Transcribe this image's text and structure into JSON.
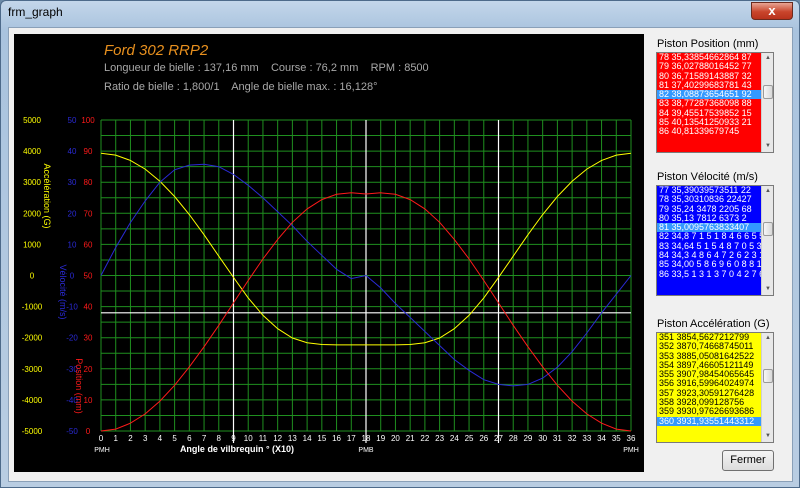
{
  "window": {
    "title": "frm_graph",
    "close_glyph": "x"
  },
  "graph": {
    "title": "Ford 302 RRP2",
    "info_line1": "Longueur de bielle : 137,16 mm    Course : 76,2 mm    RPM : 8500",
    "info_line2": "Ratio de bielle : 1,800/1    Angle de bielle max. : 16,128°",
    "xlabel": "Angle de vilbrequin ° (X10)",
    "marker_left": "PMH",
    "marker_mid": "PMB",
    "marker_right": "PMH",
    "colors": {
      "accel": "#ffff00",
      "vel": "#2a2ad6",
      "pos": "#ff1a1a",
      "grid": "#1f8f1f",
      "title": "#e8901e"
    }
  },
  "chart_data": {
    "type": "line",
    "x": [
      0,
      1,
      2,
      3,
      4,
      5,
      6,
      7,
      8,
      9,
      10,
      11,
      12,
      13,
      14,
      15,
      16,
      17,
      18,
      19,
      20,
      21,
      22,
      23,
      24,
      25,
      26,
      27,
      28,
      29,
      30,
      31,
      32,
      33,
      34,
      35,
      36
    ],
    "xlim": [
      0,
      36
    ],
    "axes": [
      {
        "label": "Accélération (G)",
        "ticks": [
          "5000",
          "4000",
          "3000",
          "2000",
          "1000",
          "0",
          "-1000",
          "-2000",
          "-3000",
          "-4000",
          "-5000"
        ],
        "ylim": [
          -5000,
          5000
        ]
      },
      {
        "label": "Vélocité (m/s)",
        "ticks": [
          "50",
          "40",
          "30",
          "20",
          "10",
          "0",
          "-10",
          "-20",
          "-30",
          "-40",
          "-50"
        ],
        "ylim": [
          -50,
          50
        ]
      },
      {
        "label": "Position (mm)",
        "ticks": [
          "100",
          "90",
          "80",
          "70",
          "60",
          "50",
          "40",
          "30",
          "20",
          "10",
          "0"
        ],
        "ylim": [
          0,
          100
        ]
      }
    ],
    "series": [
      {
        "values": [
          3930,
          3870,
          3700,
          3420,
          3030,
          2540,
          1960,
          1310,
          620,
          -60,
          -720,
          -1280,
          -1710,
          -2010,
          -2160,
          -2220,
          -2230,
          -2230,
          -2230,
          -2230,
          -2230,
          -2220,
          -2160,
          -2010,
          -1710,
          -1280,
          -720,
          -60,
          620,
          1310,
          1960,
          2540,
          3030,
          3420,
          3700,
          3870,
          3930
        ]
      },
      {
        "values": [
          0,
          9,
          17,
          24,
          30,
          34,
          35.5,
          35.8,
          35,
          32.5,
          29,
          25,
          20.5,
          16,
          11,
          6.5,
          2,
          -1,
          0,
          -4,
          -9,
          -13.5,
          -18,
          -22.5,
          -27,
          -30.5,
          -33.5,
          -35,
          -35.5,
          -35,
          -33,
          -29.5,
          -24.5,
          -18.5,
          -12,
          -6,
          0
        ]
      },
      {
        "values": [
          0,
          0.6,
          2.5,
          5.5,
          9.6,
          14.7,
          20.6,
          27.1,
          34,
          41.2,
          48.4,
          55.3,
          61.6,
          67.1,
          71.4,
          74.4,
          76.1,
          76.6,
          76.2,
          76.6,
          76.1,
          74.4,
          71.4,
          67.1,
          61.6,
          55.3,
          48.4,
          41.2,
          34,
          27.1,
          20.6,
          14.7,
          9.6,
          5.5,
          2.5,
          0.6,
          0
        ]
      }
    ],
    "vlines": [
      9,
      18,
      27
    ],
    "hline_accel": -1200,
    "grid": true
  },
  "lists": [
    {
      "label": "Piston Position (mm)",
      "bg": "#ff0000",
      "fg": "#ffffff",
      "items": [
        "78 35,33854662864 87",
        "79 36,02788016452 77",
        "80 36,71589143887 32",
        "81 37,40299683781 43",
        "82 38,08873654651 92",
        "83 38,77287368098 88",
        "84 39,45517539852 15",
        "85 40,13541250933 21",
        "86 40,81339679745"
      ],
      "selected": 4
    },
    {
      "label": "Piston Vélocité (m/s)",
      "bg": "#0000ff",
      "fg": "#ffffff",
      "items": [
        "77 35,39039573511 22",
        "78 35,30310836 22427",
        "79 35,24 3478 2205 68",
        "80 35,13 7812 6373 2",
        "81 35,0095763833407",
        "82 34,8 7 1 5 1 8 4 6 6 5 5",
        "83 34,64 5 1 5 4 8 7 0 5 3 0 2",
        "84 34,3 4 8 6 4 7 2 6 2 3 1 5 2",
        "85 34,00 5 8 6 9 6 0 8 8 1 7",
        "86 33,5 1 3 1 3 7 0 4 2 7 6"
      ],
      "selected": 4
    },
    {
      "label": "Piston Accélération (G)",
      "bg": "#ffff00",
      "fg": "#000000",
      "items": [
        "351 3854,5627212799",
        "352 3870,74668745011",
        "353 3885,05081642522",
        "354 3897,46605121149",
        "355 3907,98454065645",
        "356 3916,59964024974",
        "357 3923,30591276428",
        "358 3928,099128756",
        "359 3930,97626693686",
        "360 3931,93551443312"
      ],
      "selected": 9
    }
  ],
  "buttons": {
    "close_form": "Fermer"
  }
}
